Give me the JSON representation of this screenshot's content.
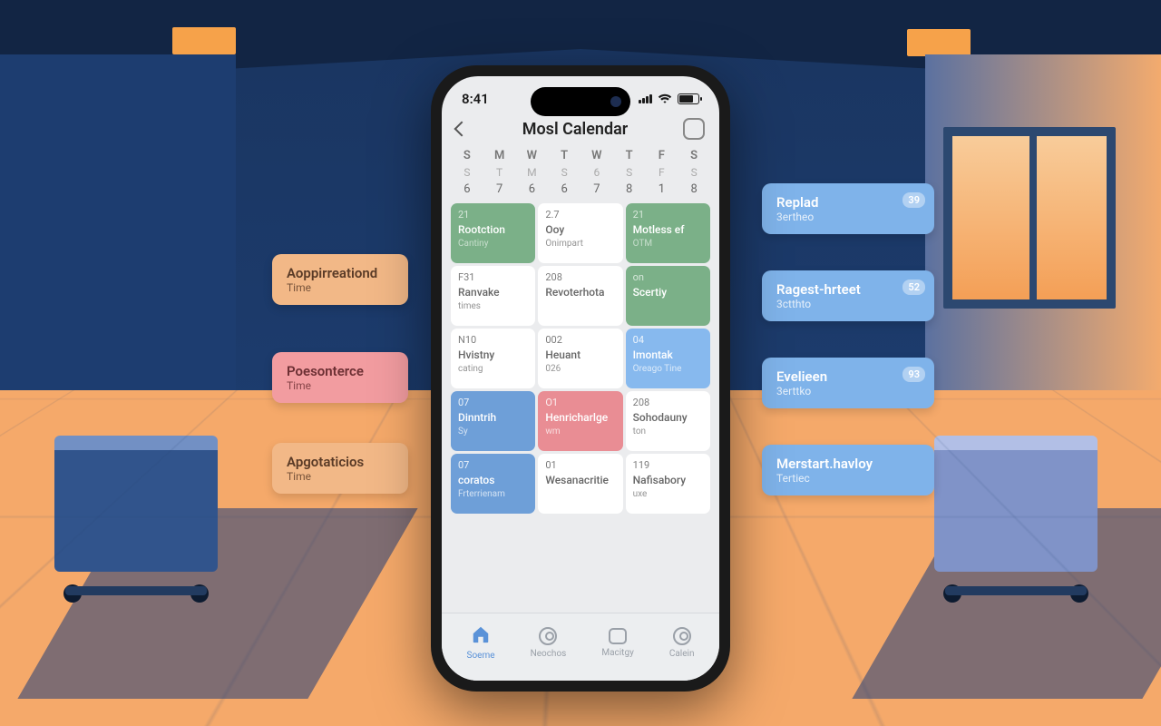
{
  "status": {
    "time": "8:41"
  },
  "nav": {
    "title": "Mosl Calendar"
  },
  "week": {
    "row1": [
      "S",
      "M",
      "W",
      "T",
      "W",
      "T",
      "F",
      "S"
    ],
    "row2": [
      "S",
      "T",
      "M",
      "S",
      "6",
      "S",
      "F",
      "S"
    ],
    "nums": [
      "6",
      "7",
      "6",
      "6",
      "7",
      "8",
      "1",
      "8"
    ]
  },
  "events": [
    {
      "cls": "green",
      "d": "21",
      "t": "Rootction",
      "s": "Cantiny"
    },
    {
      "cls": "white",
      "d": "2.7",
      "t": "Ooy",
      "s": "Onimpart"
    },
    {
      "cls": "green",
      "d": "21",
      "t": "Motless ef",
      "s": "OTM"
    },
    {
      "cls": "white",
      "d": "F31",
      "t": "Ranvake",
      "s": "times"
    },
    {
      "cls": "white",
      "d": "208",
      "t": "Revoterhota",
      "s": ""
    },
    {
      "cls": "green",
      "d": "on",
      "t": "Scertiy",
      "s": ""
    },
    {
      "cls": "white",
      "d": "N10",
      "t": "Hvistny",
      "s": "cating"
    },
    {
      "cls": "white",
      "d": "002",
      "t": "Heuant",
      "s": "026"
    },
    {
      "cls": "lblue",
      "d": "04",
      "t": "Imontak",
      "s": "Oreago Tine"
    },
    {
      "cls": "blue",
      "d": "07",
      "t": "Dinntrih",
      "s": "Sy"
    },
    {
      "cls": "pink",
      "d": "O1",
      "t": "Henricharlge",
      "s": "wm"
    },
    {
      "cls": "white",
      "d": "208",
      "t": "Sohodauny",
      "s": "ton"
    },
    {
      "cls": "blue",
      "d": "07",
      "t": "coratos",
      "s": "Frterrienam"
    },
    {
      "cls": "white",
      "d": "01",
      "t": "Wesanacritie",
      "s": ""
    },
    {
      "cls": "white",
      "d": "119",
      "t": "Nafisabory",
      "s": "uxe"
    }
  ],
  "tabs": [
    {
      "label": "Soeme",
      "active": true
    },
    {
      "label": "Neochos",
      "active": false
    },
    {
      "label": "Macitgy",
      "active": false
    },
    {
      "label": "Calein",
      "active": false
    }
  ],
  "callouts_left": [
    {
      "cls": "orange",
      "t": "Aoppirreationd",
      "s": "Time"
    },
    {
      "cls": "pink",
      "t": "Poesonterce",
      "s": "Time"
    },
    {
      "cls": "orange",
      "t": "Apgotaticios",
      "s": "Time"
    }
  ],
  "callouts_right": [
    {
      "cls": "blue",
      "t": "Replad",
      "s": "3ertheo",
      "b": "39"
    },
    {
      "cls": "blue",
      "t": "Ragest-hrteet",
      "s": "3ctthto",
      "b": "52"
    },
    {
      "cls": "blue",
      "t": "Evelieen",
      "s": "3erttko",
      "b": "93"
    },
    {
      "cls": "blue",
      "t": "Merstart.havloy",
      "s": "Tertiec",
      "b": ""
    }
  ]
}
